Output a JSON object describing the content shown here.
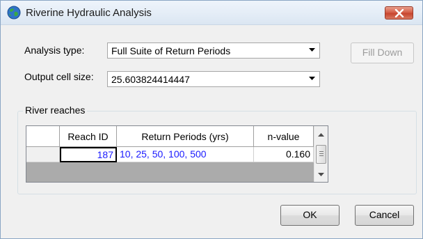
{
  "window": {
    "title": "Riverine Hydraulic Analysis"
  },
  "form": {
    "analysis_type_label": "Analysis type:",
    "analysis_type_value": "Full Suite of Return Periods",
    "output_cell_size_label": "Output cell size:",
    "output_cell_size_value": "25.603824414447",
    "fill_down_label": "Fill Down"
  },
  "river_reaches": {
    "group_label": "River reaches",
    "columns": [
      "Reach ID",
      "Return Periods (yrs)",
      "n-value"
    ],
    "rows": [
      {
        "reach_id": "187",
        "return_periods": "10, 25, 50, 100, 500",
        "n_value": "0.160"
      }
    ]
  },
  "buttons": {
    "ok_label": "OK",
    "cancel_label": "Cancel"
  },
  "colors": {
    "link_text": "#1a1aff",
    "close_button": "#c7452f"
  }
}
